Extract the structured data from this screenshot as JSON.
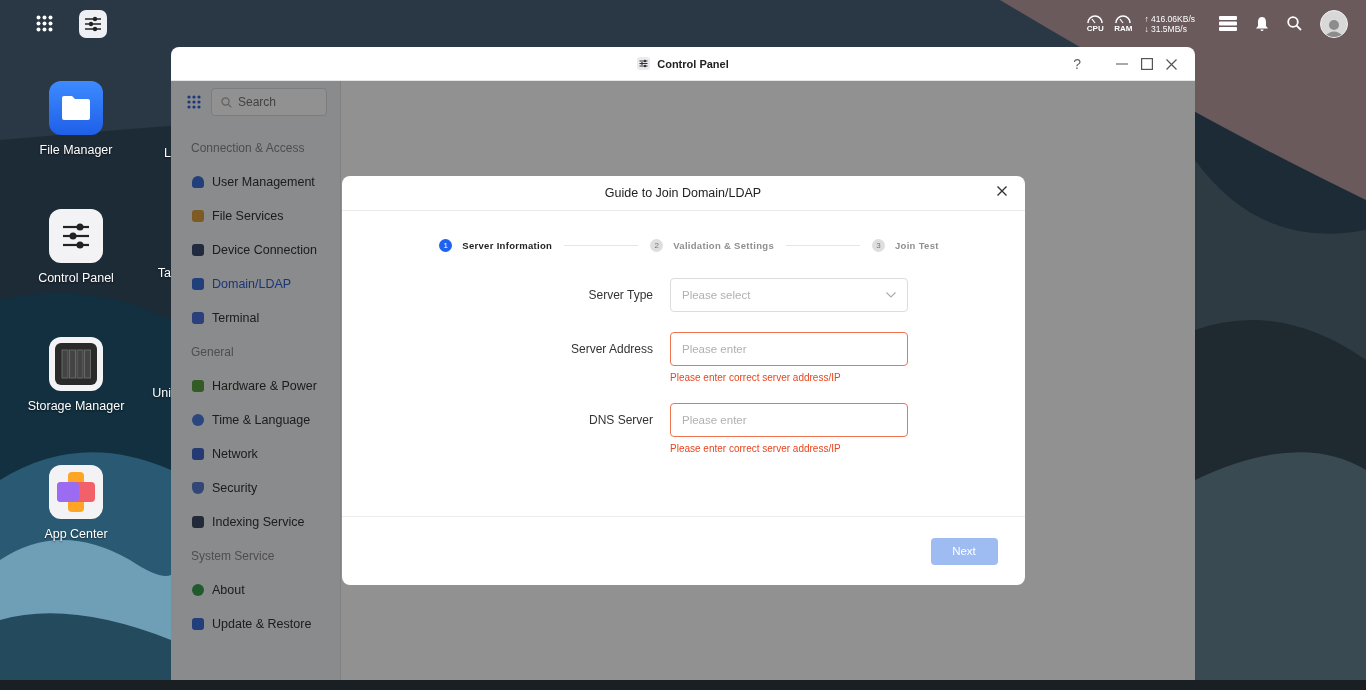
{
  "system_tray": {
    "cpu_label": "CPU",
    "ram_label": "RAM",
    "upload": "↑ 416.06KB/s",
    "download": "↓ 31.5MB/s"
  },
  "desktop_icons": [
    {
      "label": "File Manager",
      "kind": "files"
    },
    {
      "label": "Control Panel",
      "kind": "settings"
    },
    {
      "label": "Storage Manager",
      "kind": "storage"
    },
    {
      "label": "App Center",
      "kind": "apps"
    }
  ],
  "desktop_icons_column_2": [
    {
      "label": "L"
    },
    {
      "label": "Ta"
    },
    {
      "label": "Uni"
    }
  ],
  "window": {
    "title": "Control Panel",
    "help": "?"
  },
  "sidebar": {
    "search_placeholder": "Search",
    "sections": [
      {
        "heading": "Connection & Access",
        "items": [
          {
            "label": "User Management",
            "kind": "user",
            "selected": false
          },
          {
            "label": "File Services",
            "kind": "folder",
            "selected": false
          },
          {
            "label": "Device Connection",
            "kind": "device",
            "selected": false
          },
          {
            "label": "Domain/LDAP",
            "kind": "card",
            "selected": true
          },
          {
            "label": "Terminal",
            "kind": "terminal",
            "selected": false
          }
        ]
      },
      {
        "heading": "General",
        "items": [
          {
            "label": "Hardware & Power",
            "kind": "hardware",
            "selected": false
          },
          {
            "label": "Time & Language",
            "kind": "globe",
            "selected": false
          },
          {
            "label": "Network",
            "kind": "network",
            "selected": false
          },
          {
            "label": "Security",
            "kind": "shield",
            "selected": false
          },
          {
            "label": "Indexing Service",
            "kind": "index",
            "selected": false
          }
        ]
      },
      {
        "heading": "System Service",
        "items": [
          {
            "label": "About",
            "kind": "info",
            "selected": false
          },
          {
            "label": "Update & Restore",
            "kind": "sync",
            "selected": false
          }
        ]
      }
    ]
  },
  "dialog": {
    "title": "Guide to Join Domain/LDAP",
    "steps": [
      {
        "number": "1",
        "label": "Server Information",
        "selected": true
      },
      {
        "number": "2",
        "label": "Validation & Settings",
        "selected": false
      },
      {
        "number": "3",
        "label": "Join Test",
        "selected": false
      }
    ],
    "fields": [
      {
        "label": "Server Type",
        "kind": "select",
        "placeholder": "Please select",
        "invalid": false
      },
      {
        "label": "Server Address",
        "kind": "input",
        "placeholder": "Please enter",
        "invalid": true,
        "error": "Please enter correct server address/IP"
      },
      {
        "label": "DNS Server",
        "kind": "input",
        "placeholder": "Please enter",
        "invalid": true,
        "error": "Please enter correct server address/IP"
      }
    ],
    "next_button": {
      "label": "Next",
      "disabled": true
    }
  }
}
